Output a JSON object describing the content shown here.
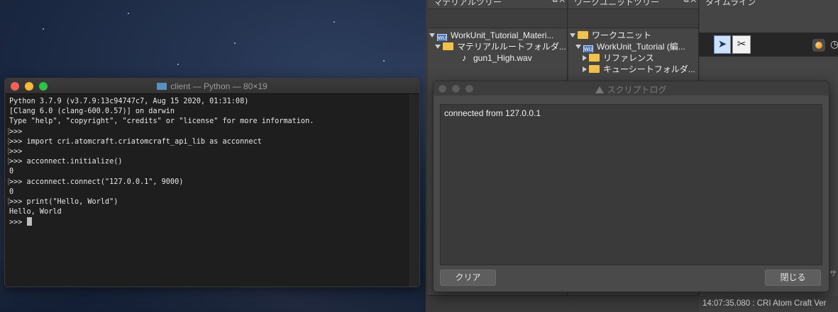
{
  "terminal": {
    "title": "client — Python — 80×19",
    "lines": [
      {
        "text": "Python 3.7.9 (v3.7.9:13c94747c7, Aug 15 2020, 01:31:08)",
        "bracket": false
      },
      {
        "text": "[Clang 6.0 (clang-600.0.57)] on darwin",
        "bracket": false
      },
      {
        "text": "Type \"help\", \"copyright\", \"credits\" or \"license\" for more information.",
        "bracket": false
      },
      {
        "text": ">>>",
        "bracket": true
      },
      {
        "text": ">>> import cri.atomcraft.criatomcraft_api_lib as acconnect",
        "bracket": true
      },
      {
        "text": ">>>",
        "bracket": true
      },
      {
        "text": ">>> acconnect.initialize()",
        "bracket": true
      },
      {
        "text": "0",
        "bracket": false
      },
      {
        "text": ">>> acconnect.connect(\"127.0.0.1\", 9000)",
        "bracket": true
      },
      {
        "text": "0",
        "bracket": false
      },
      {
        "text": ">>> print(\"Hello, World\")",
        "bracket": true
      },
      {
        "text": "Hello, World",
        "bracket": false
      }
    ],
    "prompt": ">>> "
  },
  "material_tree": {
    "header": "マテリアルツリー",
    "items": [
      {
        "label": "WorkUnit_Tutorial_Materi...",
        "icon": "workunit-icon"
      },
      {
        "label": "マテリアルルートフォルダ...",
        "icon": "folder-icon"
      },
      {
        "label": "gun1_High.wav",
        "icon": "audio-file-icon"
      }
    ]
  },
  "workunit_tree": {
    "header": "ワークユニットツリー",
    "items": [
      {
        "label": "ワークユニット",
        "icon": "folder-icon"
      },
      {
        "label": "WorkUnit_Tutorial (編...",
        "icon": "workunit-icon"
      },
      {
        "label": "リファレンス",
        "icon": "folder-icon"
      },
      {
        "label": "キューシートフォルダ...",
        "icon": "folder-icon"
      }
    ]
  },
  "timeline": {
    "header": "タイムライン"
  },
  "header_buttons": {
    "restore": "⧉",
    "close": "✕"
  },
  "script_log": {
    "title": "スクリプトログ",
    "log_text": "connected from 127.0.0.1",
    "clear_label": "クリア",
    "close_label": "閉じる"
  },
  "status_log": "14:07:35.080 : CRI Atom Craft Ver",
  "side_label": "サ"
}
